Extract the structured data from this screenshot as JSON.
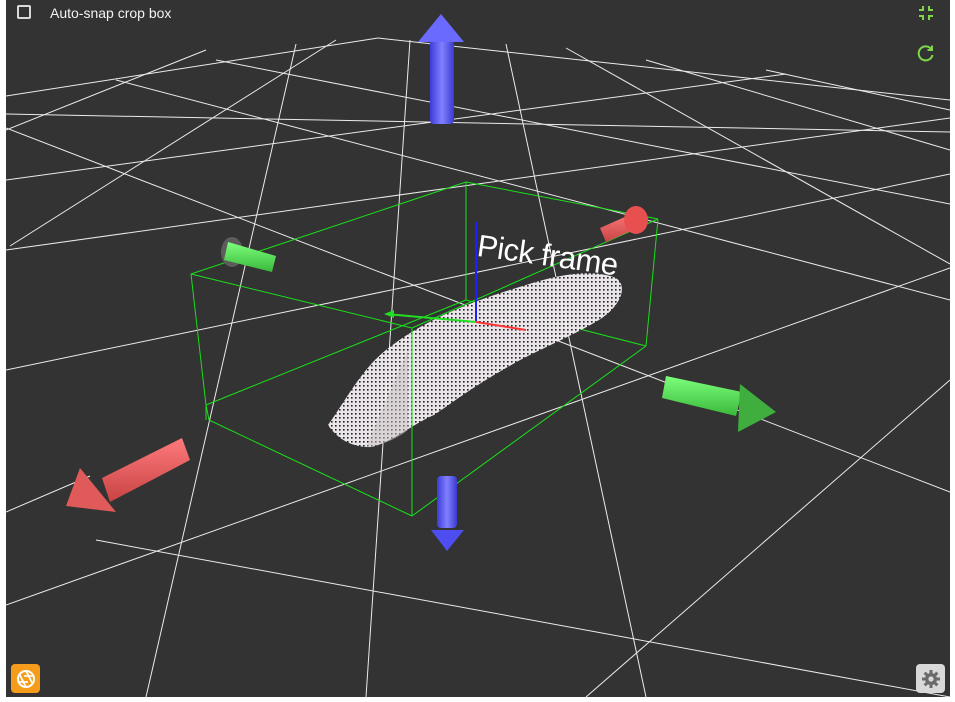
{
  "toolbar": {
    "auto_snap_label": "Auto-snap crop box",
    "auto_snap_checked": false
  },
  "viewport": {
    "frame_label": "Pick frame",
    "icons": {
      "collapse": "collapse-icon",
      "reset": "reset-view-icon",
      "camera": "camera-shutter-icon",
      "settings": "gear-icon"
    }
  },
  "colors": {
    "background": "#333333",
    "grid": "#ffffff",
    "crop_box": "#19e019",
    "x_axis": "#ff5a5a",
    "y_axis": "#3fe03f",
    "z_axis": "#5a5aff",
    "accent": "#7fd64a",
    "camera_button": "#f59c1a"
  }
}
